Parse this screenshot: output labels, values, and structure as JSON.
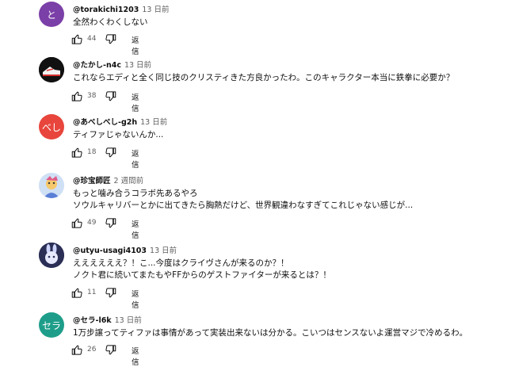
{
  "comments": [
    {
      "author": "@torakichi1203",
      "time": "13 日前",
      "avatar_text": "と",
      "avatar_color": "#7b3fa8",
      "lines": [
        "全然わくわくしない"
      ],
      "likes": "44",
      "reply_label": "返信"
    },
    {
      "author": "@たかし-n4c",
      "time": "13 日前",
      "avatar_text": "",
      "avatar_color": "#111111",
      "lines": [
        "これならエディと全く同じ技のクリスティきた方良かったわ。このキャラクター本当に鉄拳に必要か？"
      ],
      "likes": "38",
      "reply_label": "返信"
    },
    {
      "author": "@あべしべし-g2h",
      "time": "13 日前",
      "avatar_text": "べし",
      "avatar_color": "#e8453c",
      "lines": [
        "ティファじゃないんか..."
      ],
      "likes": "18",
      "reply_label": "返信"
    },
    {
      "author": "@珍宝師匠",
      "time": "2 週間前",
      "avatar_text": "",
      "avatar_color": "#dfe6f0",
      "lines": [
        "もっと噛み合うコラボ先あるやろ",
        "ソウルキャリバーとかに出てきたら胸熱だけど、世界観違わなすぎてこれじゃない感じが..."
      ],
      "likes": "49",
      "reply_label": "返信"
    },
    {
      "author": "@utyu-usagi4103",
      "time": "13 日前",
      "avatar_text": "",
      "avatar_color": "#3a3f6b",
      "lines": [
        "ええええええ？！こ...今度はクライヴさんが来るのか？！",
        "ノクト君に続いてまたもやFFからのゲストファイターが来るとは？！"
      ],
      "likes": "11",
      "reply_label": "返信"
    },
    {
      "author": "@セラ-l6k",
      "time": "13 日前",
      "avatar_text": "セラ",
      "avatar_color": "#1e9e8a",
      "lines": [
        "1万步譲ってティファは事情があって実装出来ないは分かる。こいつはセンスないよ運営マジで冷めるわ。"
      ],
      "likes": "26",
      "reply_label": "返信"
    }
  ]
}
